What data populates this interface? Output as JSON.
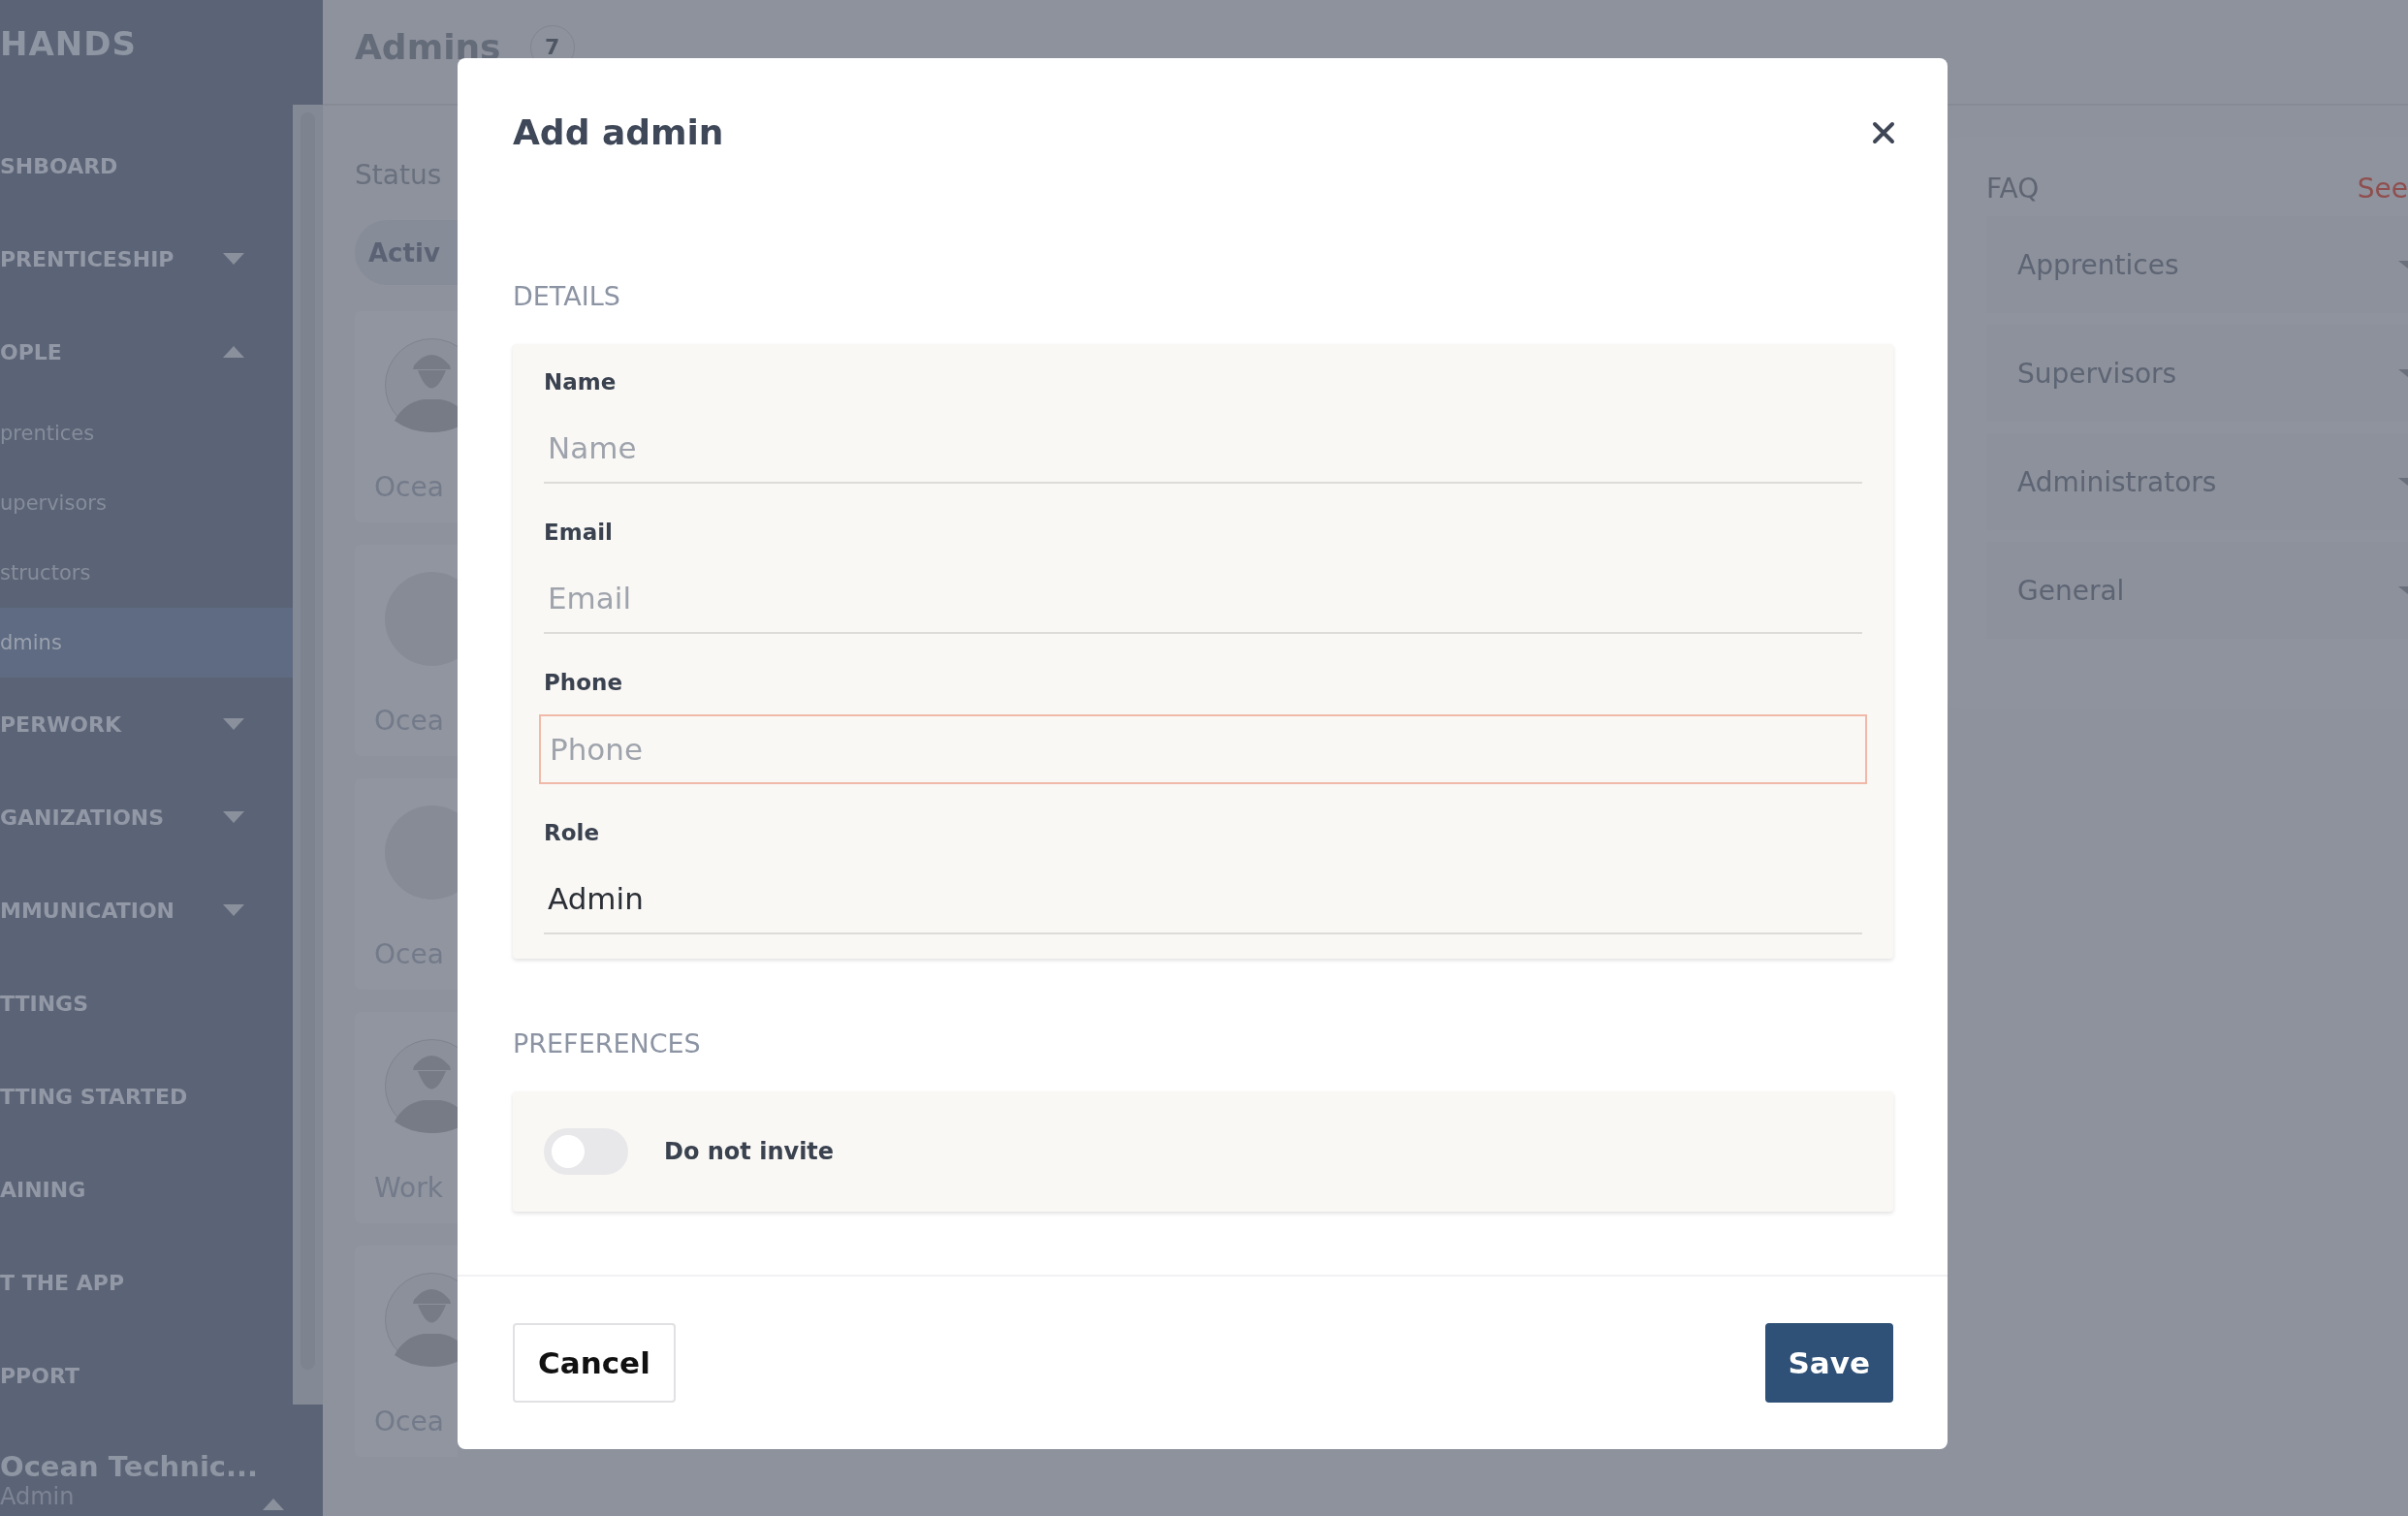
{
  "sidebar": {
    "brand": "HANDS",
    "items": [
      {
        "label": "SHBOARD",
        "kind": "link"
      },
      {
        "label": "PRENTICESHIP",
        "kind": "group",
        "expanded": false
      },
      {
        "label": "OPLE",
        "kind": "group",
        "expanded": true,
        "children": [
          {
            "label": "prentices",
            "selected": false
          },
          {
            "label": "upervisors",
            "selected": false
          },
          {
            "label": "structors",
            "selected": false
          },
          {
            "label": "dmins",
            "selected": true
          }
        ]
      },
      {
        "label": "PERWORK",
        "kind": "group",
        "expanded": false
      },
      {
        "label": "GANIZATIONS",
        "kind": "group",
        "expanded": false
      },
      {
        "label": "MMUNICATION",
        "kind": "group",
        "expanded": false
      },
      {
        "label": "TTINGS",
        "kind": "link"
      },
      {
        "label": "TTING STARTED",
        "kind": "link"
      },
      {
        "label": "AINING",
        "kind": "link"
      },
      {
        "label": "T THE APP",
        "kind": "link"
      },
      {
        "label": "PPORT",
        "kind": "link"
      }
    ],
    "account": {
      "name": "Ocean Technic...",
      "role": "Admin",
      "expanded": true
    }
  },
  "main": {
    "title": "Admins",
    "count": "7",
    "status_label": "Status",
    "filter_chip": "Activ",
    "cards": [
      {
        "name": "Ocea",
        "has_photo": false
      },
      {
        "name": "Ocea",
        "has_photo": true
      },
      {
        "name": "Ocea",
        "has_photo": true
      },
      {
        "name": "Work",
        "has_photo": false
      },
      {
        "name": "Ocea",
        "has_photo": false
      }
    ]
  },
  "faq": {
    "title": "FAQ",
    "link": "See",
    "items": [
      "Apprentices",
      "Supervisors",
      "Administrators",
      "General"
    ]
  },
  "dialog": {
    "title": "Add admin",
    "details_heading": "DETAILS",
    "fields": [
      {
        "label": "Name",
        "placeholder": "Name",
        "focused": false
      },
      {
        "label": "Email",
        "placeholder": "Email",
        "focused": false
      },
      {
        "label": "Phone",
        "placeholder": "Phone",
        "focused": true
      },
      {
        "label": "Role",
        "value": "Admin",
        "focused": false
      }
    ],
    "preferences_heading": "PREFERENCES",
    "toggles": [
      {
        "label": "Do not invite",
        "on": false
      }
    ],
    "buttons": [
      {
        "label": "Cancel",
        "kind": "secondary"
      },
      {
        "label": "Save",
        "kind": "primary"
      }
    ]
  }
}
